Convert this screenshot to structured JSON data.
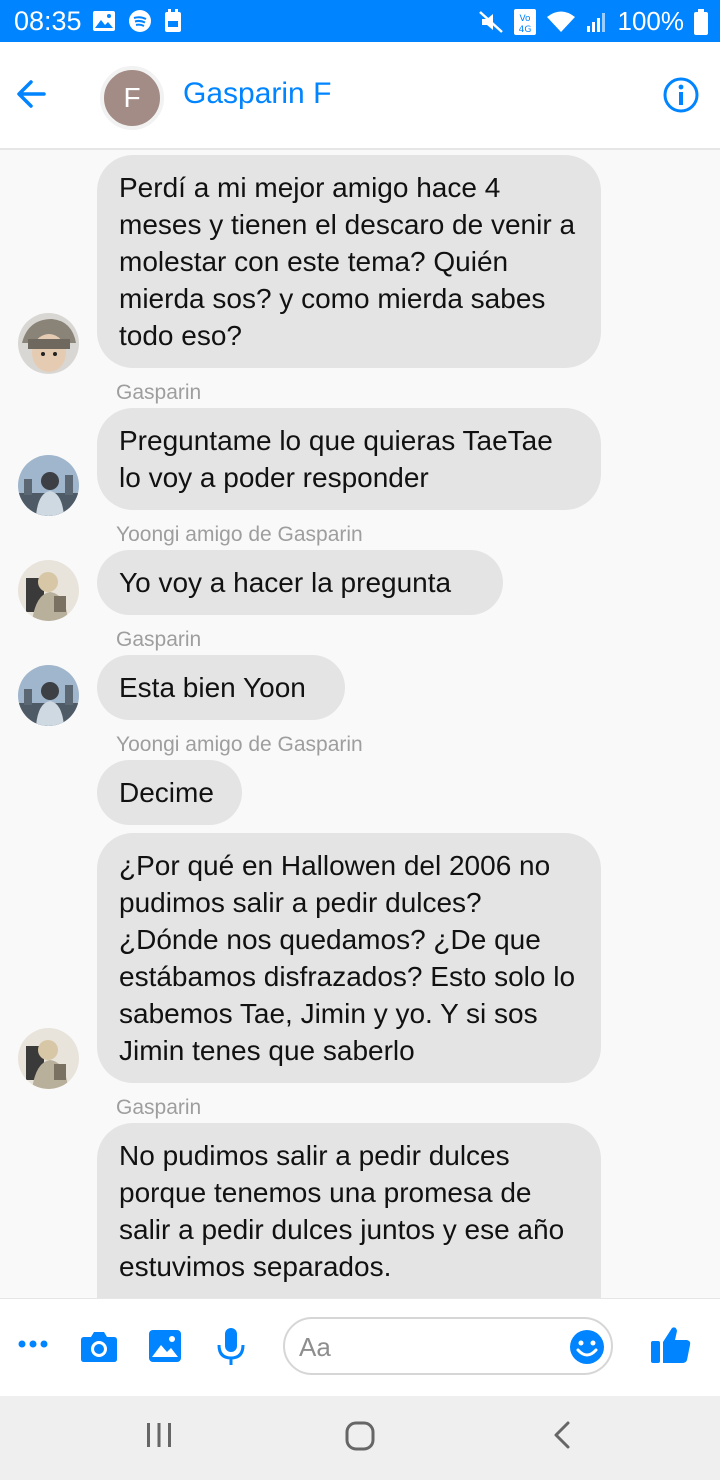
{
  "status_bar": {
    "time": "08:35",
    "battery_text": "100%",
    "icons_left": [
      "gallery-icon",
      "spotify-icon",
      "calendar-icon"
    ],
    "icons_right": [
      "mute-icon",
      "volte-icon",
      "wifi-icon",
      "signal-icon",
      "battery-icon"
    ],
    "volte_label": "Vo) LTE 4G"
  },
  "header": {
    "contact_name": "Gasparin F",
    "avatar_initial": "F",
    "avatar_color": "#a38c86",
    "accent_color": "#0084ff"
  },
  "messages": [
    {
      "sender": "",
      "text": "Perdí a mi mejor amigo hace 4 meses y tienen el descaro de venir a molestar con este tema? Quién mierda sos? y como mierda sabes todo eso?",
      "avatar": "avatar-beanie"
    },
    {
      "sender": "Gasparin",
      "text": "Preguntame lo que quieras TaeTae lo voy a poder responder",
      "avatar": "avatar-gasparin"
    },
    {
      "sender": "Yoongi amigo de Gasparin",
      "text": "Yo voy a hacer la pregunta",
      "avatar": "avatar-yoongi"
    },
    {
      "sender": "Gasparin",
      "text": "Esta bien Yoon",
      "avatar": "avatar-gasparin"
    },
    {
      "sender": "Yoongi amigo de Gasparin",
      "text": "Decime",
      "avatar": ""
    },
    {
      "sender": "",
      "text": "¿Por qué en Hallowen del 2006 no pudimos salir a pedir dulces? ¿Dónde nos quedamos? ¿De que estábamos disfrazados? Esto solo lo sabemos Tae, Jimin y yo. Y si sos Jimin tenes que saberlo",
      "avatar": "avatar-yoongi"
    },
    {
      "sender": "Gasparin",
      "text": "No pudimos salir a pedir dulces porque tenemos una promesa de salir a pedir dulces juntos y ese año estuvimos separados.",
      "avatar": ""
    }
  ],
  "composer": {
    "placeholder": "Aa"
  },
  "colors": {
    "bubble": "#e4e4e4",
    "chat_bg": "#f9f9f9",
    "status_bar": "#0084ff"
  }
}
